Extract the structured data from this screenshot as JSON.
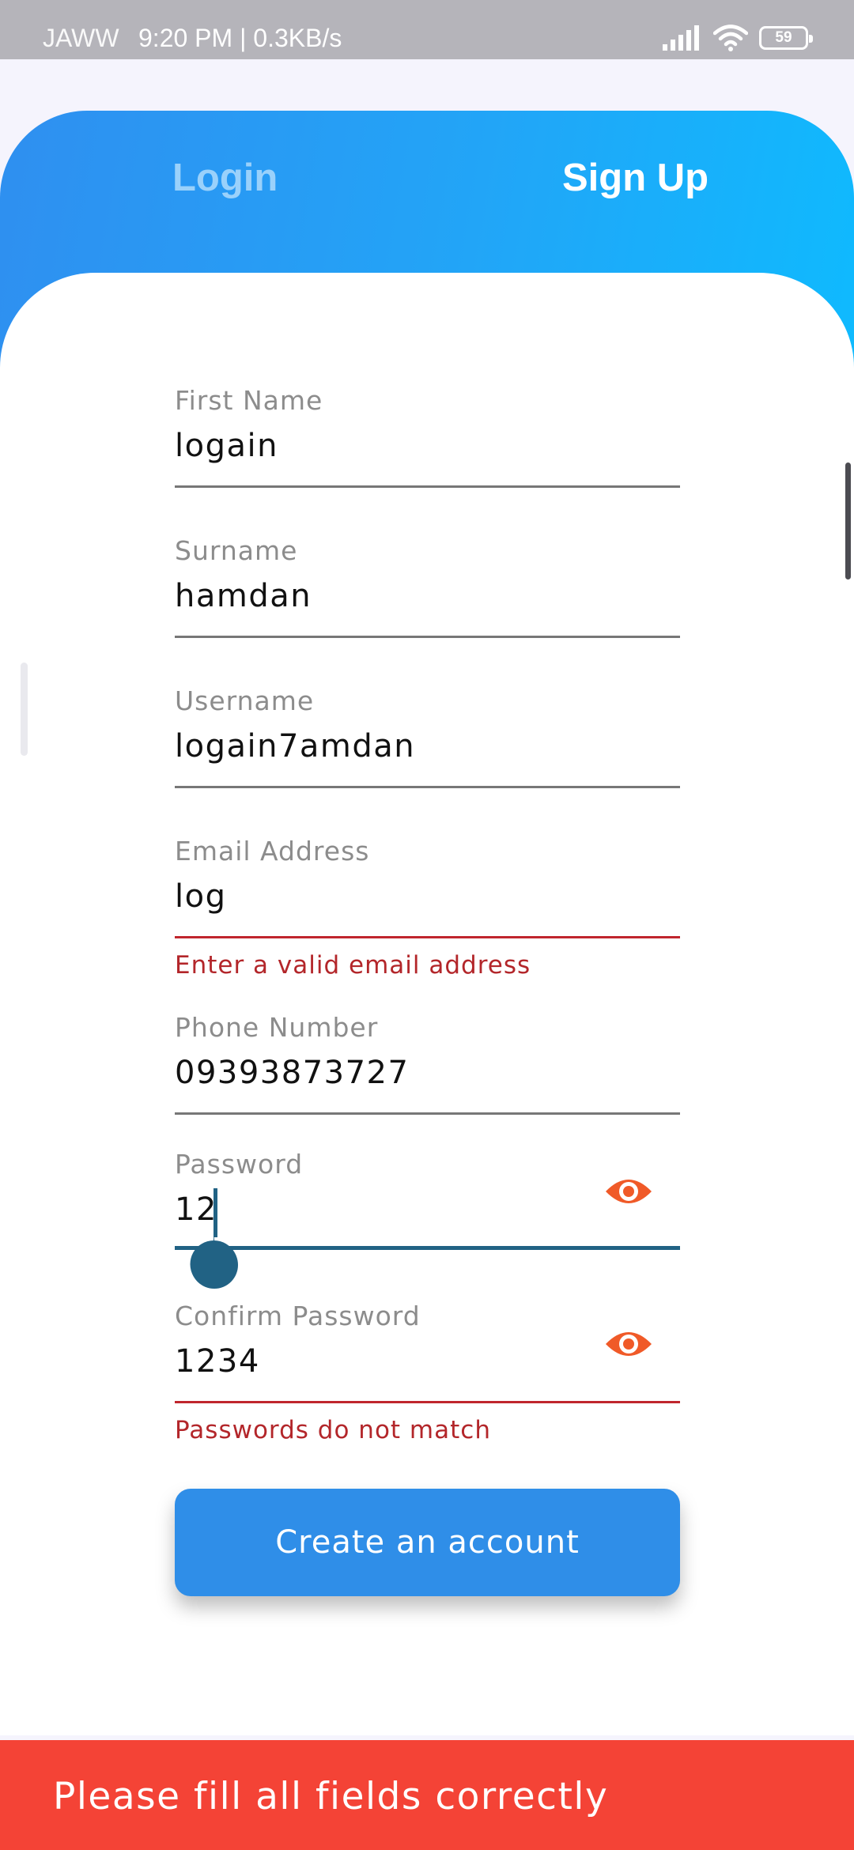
{
  "status_bar": {
    "carrier": "JAWW",
    "time": "9:20 PM | 0.3KB/s",
    "battery": "59",
    "icons": [
      "signal-icon",
      "wifi-icon",
      "battery-icon"
    ]
  },
  "tabs": {
    "login_label": "Login",
    "signup_label": "Sign Up",
    "active": "Sign Up"
  },
  "form": {
    "first_name": {
      "label": "First Name",
      "value": "logain"
    },
    "surname": {
      "label": "Surname",
      "value": "hamdan"
    },
    "username": {
      "label": "Username",
      "value": "logain7amdan"
    },
    "email": {
      "label": "Email Address",
      "value": "log",
      "error": "Enter a valid email address"
    },
    "phone": {
      "label": "Phone Number",
      "value": "09393873727"
    },
    "password": {
      "label": "Password",
      "value": "12",
      "icon": "eye-icon"
    },
    "confirm_password": {
      "label": "Confirm Password",
      "value": "1234",
      "error": "Passwords do not match",
      "icon": "eye-icon"
    },
    "submit_label": "Create an account"
  },
  "snackbar": {
    "message": "Please fill all fields correctly"
  },
  "colors": {
    "gradient_start": "#2f8ff0",
    "gradient_end": "#0fbafe",
    "button": "#2f8ee8",
    "error": "#b3262a",
    "snackbar": "#f44336",
    "eye_icon": "#f05a28",
    "focus": "#216284"
  }
}
